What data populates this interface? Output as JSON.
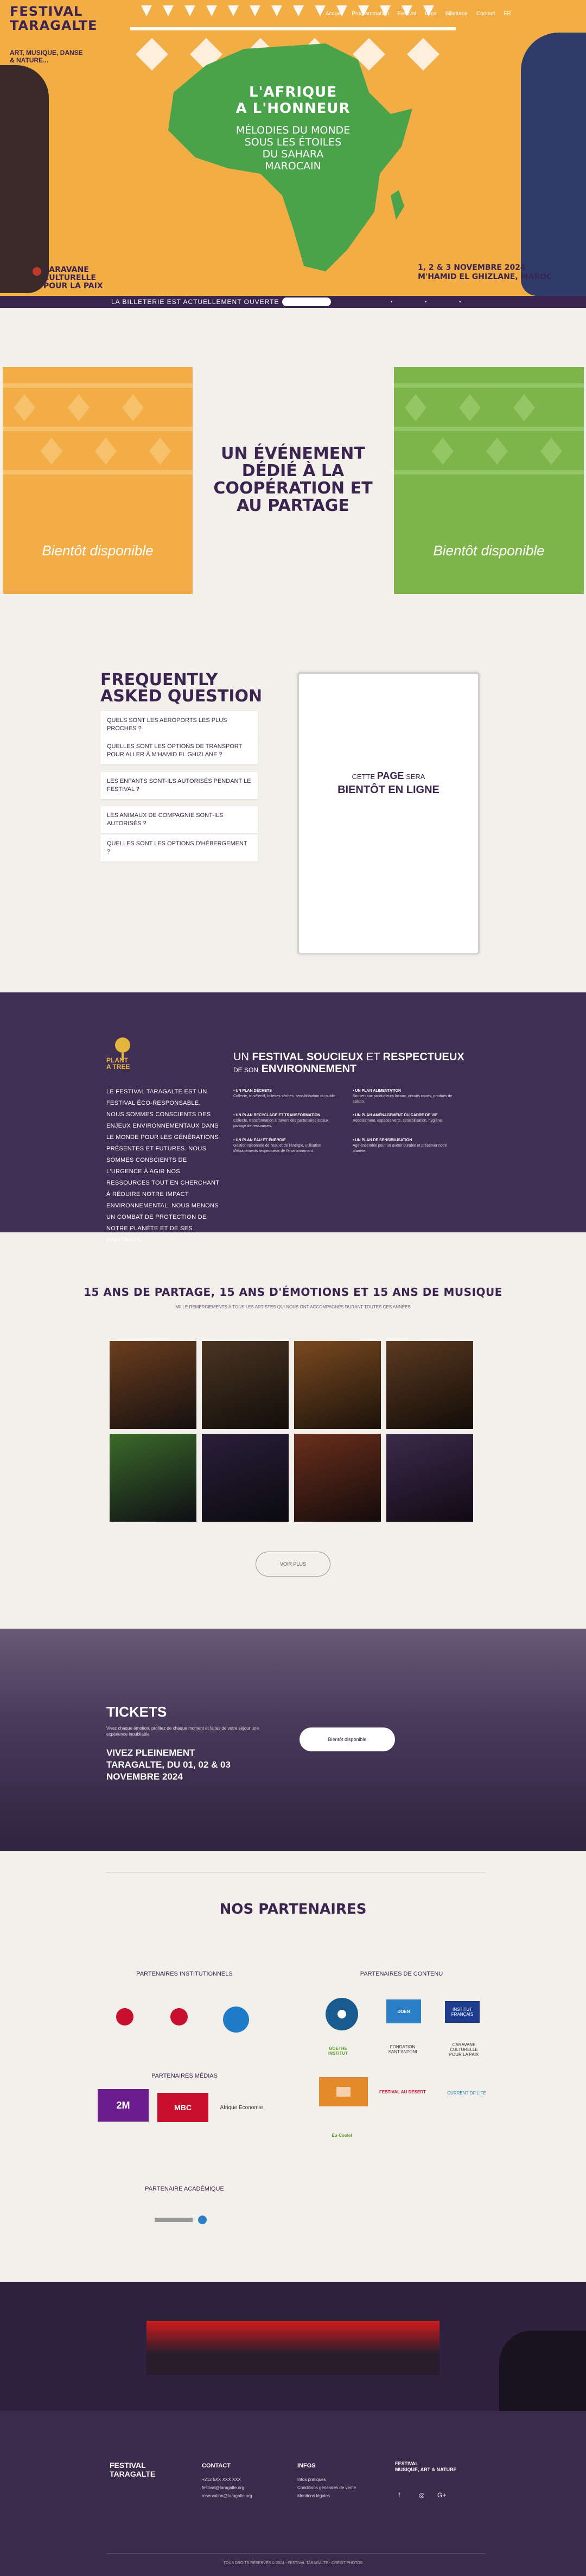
{
  "header": {
    "logo_title": "FESTIVAL\nTARAGALTE",
    "logo_tagline": "ART, MUSIQUE, DANSE\n& NATURE...",
    "nav": [
      "Accueil",
      "Programmation",
      "Festival",
      "Infos",
      "Billetterie",
      "Contact",
      "FR"
    ]
  },
  "hero": {
    "headline": "L'AFRIQUE\nA L'HONNEUR",
    "subline": "MÉLODIES DU MONDE\nSOUS LES ÉTOILES\nDU SAHARA\nMAROCAIN",
    "caravane": "CARAVANE\nCULTURELLE\nPOUR LA PAIX",
    "date": "1, 2 & 3 NOVEMBRE 2024\nM'HAMID EL GHIZLANE, MAROC"
  },
  "strip": {
    "text": "LA BILLETERIE EST ACTUELLEMENT OUVERTE"
  },
  "event": {
    "title": "UN ÉVÉNEMENT\nDÉDIÉ À LA\nCOOPÉRATION ET\nAU PARTAGE",
    "card_left_label": "Bientôt   disponible",
    "card_right_label": "Bientôt   disponible"
  },
  "faq": {
    "title": "FREQUENTLY\nASKED QUESTION",
    "items": [
      "QUELS SONT LES AEROPORTS LES PLUS PROCHES ?",
      "QUELLES SONT LES OPTIONS DE TRANSPORT POUR ALLER À M'HAMID EL GHIZLANE ?",
      "LES ENFANTS SONT-ILS AUTORISÉS PENDANT LE FESTIVAL ?",
      "LES ANIMAUX DE COMPAGNIE SONT-ILS AUTORISÉS ?",
      "QUELLES SONT LES OPTIONS D'HÉBERGEMENT ?"
    ],
    "page_box": {
      "line1_pre": "CETTE",
      "line1_strong": "PAGE",
      "line1_post": "SERA",
      "line2": "BIENTÔT EN LIGNE"
    }
  },
  "environment": {
    "badge": "PLANT\nA TREE",
    "left_text": "LE FESTIVAL TARAGALTE EST UN FESTIVAL ÉCO-RESPONSABLE. NOUS SOMMES CONSCIENTS DES ENJEUX ENVIRONNEMENTAUX DANS LE MONDE POUR LES GÉNÉRATIONS PRÉSENTES ET FUTURES. NOUS SOMMES CONSCIENTS DE L'URGENCE À AGIR NOS RESSOURCES TOUT EN CHERCHANT À RÉDUIRE NOTRE IMPACT ENVIRONNEMENTAL. NOUS MENONS UN COMBAT DE PROTECTION DE NOTRE PLANÈTE ET DE SES HABITANTS.",
    "title_prefix": "UN",
    "title_strong": "FESTIVAL SOUCIEUX",
    "title_mid": "ET",
    "title_strong2": "RESPECTUEUX",
    "title_line2_prefix": "DE SON",
    "title_line2_strong": "ENVIRONNEMENT",
    "points": [
      {
        "title": "• UN PLAN DÉCHETS",
        "text": "Collecte, tri sélectif, toilettes sèches, sensibilisation du public."
      },
      {
        "title": "• UN PLAN RECYCLAGE ET TRANSFORMATION",
        "text": "Collecte, transformation à travers des partenaires locaux, partage de ressources."
      },
      {
        "title": "• UN PLAN EAU ET ÉNERGIE",
        "text": "Gestion raisonnée de l'eau et de l'énergie, utilisation d'équipements respectueux de l'environnement."
      },
      {
        "title": "• UN PLAN ALIMENTATION",
        "text": "Soutien aux producteurs locaux, circuits courts, produits de saison."
      },
      {
        "title": "• UN PLAN AMÉNAGEMENT DU CADRE DE VIE",
        "text": "Reboisement, espaces verts, sensibilisation, hygiène."
      },
      {
        "title": "• UN PLAN DE SENSIBILISATION",
        "text": "Agir ensemble pour un avenir durable et préserver notre planète."
      }
    ]
  },
  "gallery": {
    "title": "15 ANS DE PARTAGE, 15 ANS D'ÉMOTIONS ET 15 ANS DE MUSIQUE",
    "subtitle": "MILLE REMERCIEMENTS À TOUS LES ARTISTES QUI NOUS ONT ACCOMPAGNÉS DURANT TOUTES CES ANNÉES",
    "button": "VOIR PLUS"
  },
  "tickets": {
    "title": "TICKETS",
    "text": "Vivez chaque émotion, profitez de chaque moment et faites de votre séjour une expérience inoubliable",
    "headline": "VIVEZ PLEINEMENT TARAGALTE, DU 01, 02 & 03 NOVEMBRE 2024",
    "button": "Bientôt disponible"
  },
  "partners": {
    "title": "NOS PARTENAIRES",
    "institutional_title": "PARTENAIRES INSTITUTIONNELS",
    "content_title": "PARTENAIRES DE CONTENU",
    "media_title": "PARTENAIRES MÉDIAS",
    "academic_title": "PARTENAIRE ACADÉMIQUE",
    "content_logos": [
      "DOEN",
      "FONDATION SANT'ANTONI",
      "CARAVANE CULTURELLE POUR LA PAIX",
      "GOETHE INSTITUT",
      "FESTIVAL AU DESERT",
      "CURRENT OF LIFE",
      "Eu-Coolel",
      "INSTITUT FRANÇAIS"
    ],
    "media_logos": [
      "2M",
      "MBC",
      "Afrique Economie"
    ]
  },
  "footer": {
    "logo": "FESTIVAL\nTARAGALTE",
    "contact_title": "CONTACT",
    "contact_items": [
      "+212 6XX XXX XXX",
      "festival@taragalte.org",
      "reservation@taragalte.org"
    ],
    "infos_title": "INFOS",
    "infos_items": [
      "Infos pratiques",
      "Conditions générales de vente",
      "Mentions légales"
    ],
    "partner_logo": "FESTIVAL\nMUSIQUE, ART & NATURE",
    "copyright": "TOUS DROITS RÉSERVÉS © 2024 - FESTIVAL TARAGALTE - CRÉDIT PHOTOS"
  }
}
